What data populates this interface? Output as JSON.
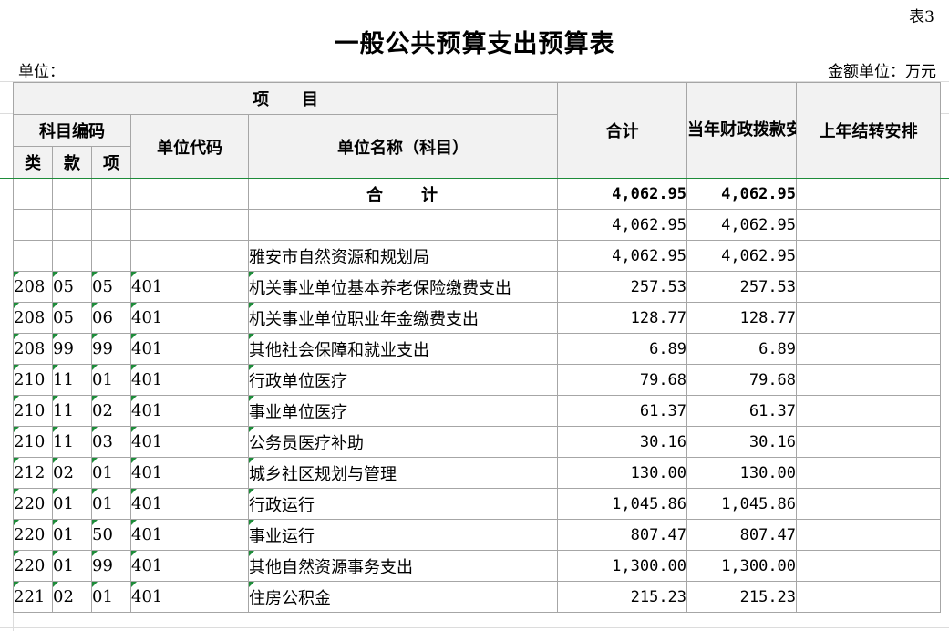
{
  "tag": "表3",
  "title": "一般公共预算支出预算表",
  "unit_left": "单位：",
  "unit_right": "金额单位：万元",
  "header": {
    "item": "项　　目",
    "subject_code": "科目编码",
    "lei": "类",
    "kuan": "款",
    "xiang": "项",
    "unit_code": "单位代码",
    "unit_name": "单位名称（科目）",
    "total": "合计",
    "current_year": "当年财政拨款安排",
    "last_year": "上年结转安排"
  },
  "total_row": {
    "label": "合　　计",
    "total": "4,062.95",
    "current": "4,062.95",
    "last": ""
  },
  "summary_rows": [
    {
      "name": "",
      "total": "4,062.95",
      "current": "4,062.95",
      "last": ""
    },
    {
      "name": "雅安市自然资源和规划局",
      "total": "4,062.95",
      "current": "4,062.95",
      "last": ""
    }
  ],
  "rows": [
    {
      "lei": "208",
      "kuan": "05",
      "xiang": "05",
      "code": "401",
      "name": "机关事业单位基本养老保险缴费支出",
      "total": "257.53",
      "current": "257.53",
      "last": ""
    },
    {
      "lei": "208",
      "kuan": "05",
      "xiang": "06",
      "code": "401",
      "name": "机关事业单位职业年金缴费支出",
      "total": "128.77",
      "current": "128.77",
      "last": ""
    },
    {
      "lei": "208",
      "kuan": "99",
      "xiang": "99",
      "code": "401",
      "name": "其他社会保障和就业支出",
      "total": "6.89",
      "current": "6.89",
      "last": ""
    },
    {
      "lei": "210",
      "kuan": "11",
      "xiang": "01",
      "code": "401",
      "name": "行政单位医疗",
      "total": "79.68",
      "current": "79.68",
      "last": ""
    },
    {
      "lei": "210",
      "kuan": "11",
      "xiang": "02",
      "code": "401",
      "name": "事业单位医疗",
      "total": "61.37",
      "current": "61.37",
      "last": ""
    },
    {
      "lei": "210",
      "kuan": "11",
      "xiang": "03",
      "code": "401",
      "name": "公务员医疗补助",
      "total": "30.16",
      "current": "30.16",
      "last": ""
    },
    {
      "lei": "212",
      "kuan": "02",
      "xiang": "01",
      "code": "401",
      "name": "城乡社区规划与管理",
      "total": "130.00",
      "current": "130.00",
      "last": ""
    },
    {
      "lei": "220",
      "kuan": "01",
      "xiang": "01",
      "code": "401",
      "name": "行政运行",
      "total": "1,045.86",
      "current": "1,045.86",
      "last": ""
    },
    {
      "lei": "220",
      "kuan": "01",
      "xiang": "50",
      "code": "401",
      "name": "事业运行",
      "total": "807.47",
      "current": "807.47",
      "last": ""
    },
    {
      "lei": "220",
      "kuan": "01",
      "xiang": "99",
      "code": "401",
      "name": "其他自然资源事务支出",
      "total": "1,300.00",
      "current": "1,300.00",
      "last": ""
    },
    {
      "lei": "221",
      "kuan": "02",
      "xiang": "01",
      "code": "401",
      "name": "住房公积金",
      "total": "215.23",
      "current": "215.23",
      "last": ""
    }
  ]
}
